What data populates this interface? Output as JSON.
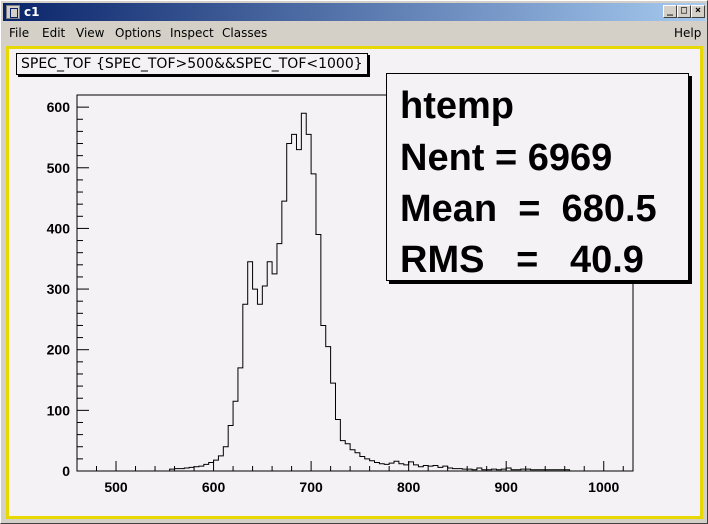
{
  "window": {
    "title": "c1",
    "buttons": {
      "minimize": "_",
      "maximize": "□",
      "close": "×"
    }
  },
  "menu": {
    "items": [
      "File",
      "Edit",
      "View",
      "Options",
      "Inspect",
      "Classes"
    ],
    "help": "Help"
  },
  "histogram": {
    "title": "SPEC_TOF {SPEC_TOF>500&&SPEC_TOF<1000}",
    "line_color": "#000000",
    "canvas_border_color": "#e6d800"
  },
  "stats": {
    "name": "htemp",
    "lines": [
      "Nent = 6969",
      "Mean  =  680.5",
      "RMS   =   40.9"
    ]
  },
  "chart_data": {
    "type": "bar",
    "title": "SPEC_TOF {SPEC_TOF>500&&SPEC_TOF<1000}",
    "xlim": [
      460,
      1030
    ],
    "ylim": [
      0,
      620
    ],
    "x_ticks": [
      500,
      600,
      700,
      800,
      900,
      1000
    ],
    "y_ticks": [
      0,
      100,
      200,
      300,
      400,
      500,
      600
    ],
    "bin_edges": [
      555,
      560,
      565,
      570,
      575,
      580,
      585,
      590,
      595,
      600,
      605,
      610,
      615,
      620,
      625,
      630,
      635,
      640,
      645,
      650,
      655,
      660,
      665,
      670,
      675,
      680,
      685,
      690,
      695,
      700,
      705,
      710,
      715,
      720,
      725,
      730,
      735,
      740,
      745,
      750,
      755,
      760,
      765,
      770,
      775,
      780,
      785,
      790,
      795,
      800,
      805,
      810,
      815,
      820,
      825,
      830,
      835,
      840,
      845,
      850,
      855,
      860,
      865,
      870,
      875,
      880,
      885,
      890,
      895,
      900,
      905,
      910,
      915,
      920,
      925,
      930,
      935,
      940,
      945,
      950,
      955,
      960,
      965
    ],
    "values": [
      3,
      4,
      4,
      5,
      6,
      7,
      8,
      11,
      14,
      18,
      25,
      40,
      75,
      115,
      170,
      275,
      345,
      300,
      275,
      305,
      345,
      325,
      375,
      445,
      540,
      555,
      530,
      590,
      555,
      490,
      390,
      240,
      205,
      145,
      85,
      50,
      45,
      35,
      30,
      24,
      20,
      17,
      14,
      12,
      11,
      13,
      16,
      12,
      10,
      15,
      10,
      7,
      9,
      8,
      9,
      6,
      8,
      5,
      4,
      4,
      3,
      3,
      2,
      5,
      2,
      2,
      3,
      2,
      3,
      5,
      2,
      2,
      3,
      3,
      2,
      2,
      2,
      2,
      2,
      2,
      2,
      2
    ]
  }
}
